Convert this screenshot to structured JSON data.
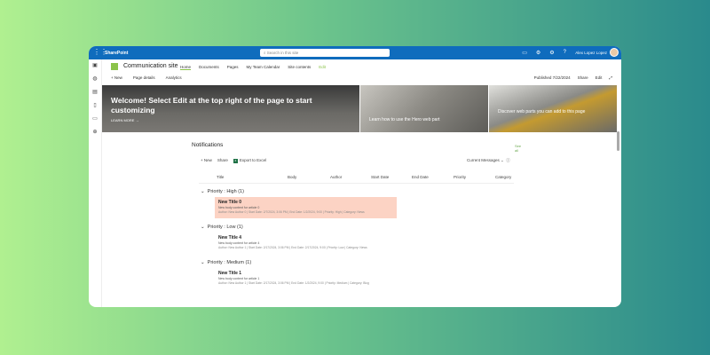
{
  "topbar": {
    "app": "SharePoint",
    "search_placeholder": "Search in this site",
    "user": "Alex Lopez Lopez"
  },
  "site": {
    "name": "Communication site",
    "nav": [
      "Home",
      "Documents",
      "Pages",
      "My Team Calendar",
      "Site contents",
      "Edit"
    ],
    "commands": [
      "+ New",
      "Page details",
      "Analytics"
    ],
    "published": "Published 7/22/2024",
    "share": "Share",
    "edit": "Edit"
  },
  "hero": {
    "main_title": "Welcome! Select Edit at the top right of the page to start customizing",
    "learn_more": "LEARN MORE →",
    "tile2": "Learn how to use the Hero web part",
    "tile3": "Discover web parts you can add to this page"
  },
  "notifications": {
    "title": "Notifications",
    "see_all": "See all",
    "toolbar": {
      "new": "+ New",
      "share": "Share",
      "export": "Export to Excel",
      "view": "Current Messages"
    },
    "columns": [
      "Title",
      "Body",
      "Author",
      "Start Date",
      "End Date",
      "Priority",
      "Category"
    ],
    "groups": [
      {
        "label": "Priority : High (1)",
        "title": "New Title 0",
        "body": "New body content for article 0",
        "meta": "Author: New Author 0 | Start Date: 2/7/2024, 3:06 PM | End Date: 1/2/2024, 9:00 | Priority: High | Category: News"
      },
      {
        "label": "Priority : Low (1)",
        "title": "New Title 4",
        "body": "New body content for article 4",
        "meta": "Author: New Author 1 | Start Date: 2/17/2024, 3:06 PM | End Date: 2/17/2024, 9:00 | Priority: Low | Category: News"
      },
      {
        "label": "Priority : Medium (1)",
        "title": "New Title 1",
        "body": "New body content for article 1",
        "meta": "Author: New Author 1 | Start Date: 2/17/2024, 3:06 PM | End Date: 1/2/2024, 9:00 | Priority: Medium | Category: Blog"
      }
    ]
  }
}
